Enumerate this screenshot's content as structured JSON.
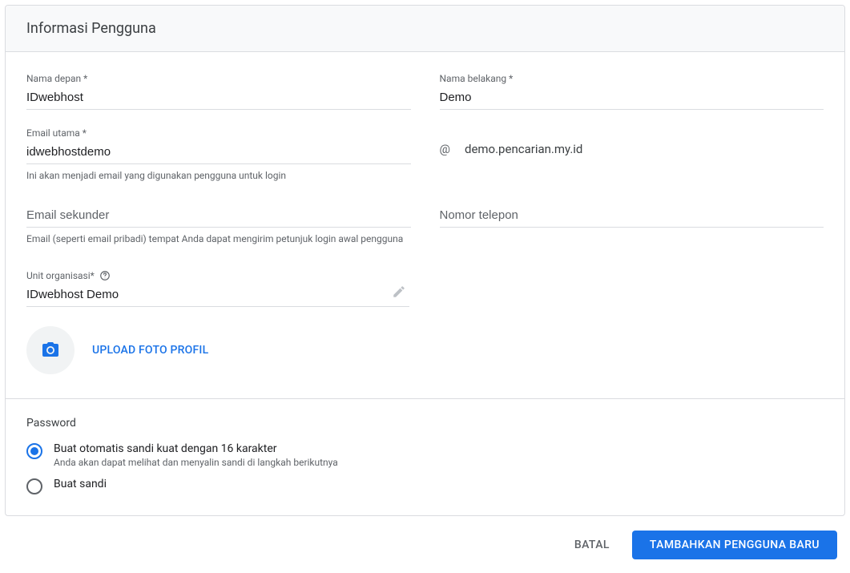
{
  "header": {
    "title": "Informasi Pengguna"
  },
  "fields": {
    "first_name": {
      "label": "Nama depan *",
      "value": "IDwebhost"
    },
    "last_name": {
      "label": "Nama belakang *",
      "value": "Demo"
    },
    "primary_email": {
      "label": "Email utama *",
      "value": "idwebhostdemo",
      "helper": "Ini akan menjadi email yang digunakan pengguna untuk login",
      "at": "@",
      "domain": "demo.pencarian.my.id"
    },
    "secondary_email": {
      "placeholder": "Email sekunder",
      "helper": "Email (seperti email pribadi) tempat Anda dapat mengirim petunjuk login awal pengguna"
    },
    "phone": {
      "placeholder": "Nomor telepon"
    },
    "org_unit": {
      "label": "Unit organisasi*",
      "value": "IDwebhost Demo"
    }
  },
  "upload": {
    "label": "UPLOAD FOTO PROFIL"
  },
  "password": {
    "title": "Password",
    "options": {
      "auto": {
        "label": "Buat otomatis sandi kuat dengan 16 karakter",
        "helper": "Anda akan dapat melihat dan menyalin sandi di langkah berikutnya"
      },
      "manual": {
        "label": "Buat sandi"
      }
    }
  },
  "footer": {
    "cancel": "BATAL",
    "submit": "TAMBAHKAN PENGGUNA BARU"
  }
}
